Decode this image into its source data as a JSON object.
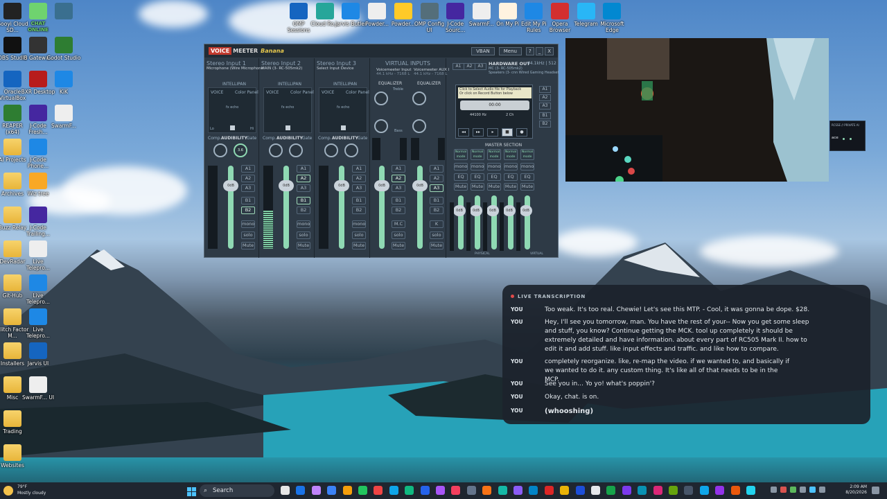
{
  "desktop_left": [
    {
      "label": "Gooyi Cloud SD...",
      "color": "#222"
    },
    {
      "label": "CHAT ONLINE",
      "color": "#6fd36f"
    },
    {
      "label": "",
      "color": "#3a6f8f"
    },
    {
      "label": "OBS Studio",
      "color": "#111"
    },
    {
      "label": "IB Gatewa...",
      "color": "#333"
    },
    {
      "label": "Godot Studio",
      "color": "#2e7d32"
    },
    {
      "label": "Oracle VirtualBox",
      "color": "#1565c0"
    },
    {
      "label": "BXR Desktop",
      "color": "#b71c1c"
    },
    {
      "label": "KiK",
      "color": "#1e88e5"
    },
    {
      "label": "REAPER (x64)",
      "color": "#2e7d32"
    },
    {
      "label": "J-Code Fresh...",
      "color": "#4527a0"
    },
    {
      "label": "SwarmF...",
      "color": "#eee"
    },
    {
      "label": "AI Projects",
      "color": "folder"
    },
    {
      "label": "J-Code Phone...",
      "color": "#1e88e5"
    },
    {
      "label": "Archives",
      "color": "folder"
    },
    {
      "label": "Wiz tree",
      "color": "#f9a825"
    },
    {
      "label": "Buzz Relay",
      "color": "folder"
    },
    {
      "label": "J-Code Trailing...",
      "color": "#4527a0"
    },
    {
      "label": "DevRadar",
      "color": "folder"
    },
    {
      "label": "Live Telepro...",
      "color": "#eee"
    },
    {
      "label": "Git-Hub",
      "color": "folder"
    },
    {
      "label": "Live Telepro...",
      "color": "#1e88e5"
    },
    {
      "label": "Glitch Factor M...",
      "color": "folder"
    },
    {
      "label": "Live Telepro...",
      "color": "#1e88e5"
    },
    {
      "label": "Installers",
      "color": "folder"
    },
    {
      "label": "Jarvis UI",
      "color": "#1565c0"
    },
    {
      "label": "Misc",
      "color": "folder"
    },
    {
      "label": "SwarmF... UI",
      "color": "#eee"
    },
    {
      "label": "Trading",
      "color": "folder"
    },
    {
      "label": "Websites",
      "color": "folder"
    }
  ],
  "desktop_top": [
    {
      "label": "OMP Sessions",
      "color": "#1565c0"
    },
    {
      "label": "Cloud Ro...",
      "color": "#26a69a"
    },
    {
      "label": "Jarvis Butler",
      "color": "#1e88e5"
    },
    {
      "label": "Powder...",
      "color": "#eeeeee"
    },
    {
      "label": "Powder...",
      "color": "#ffca28"
    },
    {
      "label": "OMP Config UI",
      "color": "#546e7a"
    },
    {
      "label": "J-Code Sourc...",
      "color": "#4527a0"
    },
    {
      "label": "SwarmF...",
      "color": "#eeeeee"
    },
    {
      "label": "On My Pi",
      "color": "#fff3e0"
    },
    {
      "label": "Edit My Pi Rules",
      "color": "#1e88e5"
    },
    {
      "label": "Opera Browser",
      "color": "#d32f2f"
    },
    {
      "label": "Telegram",
      "color": "#29b6f6"
    },
    {
      "label": "Microsoft Edge",
      "color": "#0288d1"
    }
  ],
  "voicemeeter": {
    "logo_voice": "VOICE",
    "logo_meeter": "MEETER",
    "logo_banana": "Banana",
    "vban": "VBAN",
    "menu": "Menu",
    "help": "?",
    "minimize": "_",
    "close": "X",
    "strips": [
      {
        "name": "Stereo Input 1",
        "device": "Microphone (Wire Microphone"
      },
      {
        "name": "Stereo Input 2",
        "device": "MAIN (3- RC-505mk2)"
      },
      {
        "name": "Stereo Input 3",
        "device": "Select Input Device"
      }
    ],
    "virtual_inputs": "VIRTUAL INPUTS",
    "virt1": "Voicemeeter Input",
    "virt1_rate": "44.1 kHz - 7168 L",
    "virt2": "Voicemeeter AUX I",
    "virt2_rate": "44.1 kHz - 7168 L",
    "hardware_out": "HARDWARE OUT",
    "hardware_rate": "44.1kHz | 512",
    "hw_a1": "MC (3- RC-505mk2)",
    "hw_a2": "Speakers (3- cnn Wired Gaming Headset",
    "intellipan": "INTELLIPAN",
    "voice": "VOICE",
    "color_panel": "Color Panel",
    "fx_echo": "fx echo",
    "brightness": "brightness",
    "lo": "Lo",
    "hi": "Hi",
    "comp": "Comp.",
    "audibility": "AUDIBILITY",
    "gate": "Gate",
    "equalizer": "EQUALIZER",
    "treble": "Treble",
    "bass": "Bass",
    "fader_gain": "Fader Gain",
    "db": "0dB",
    "knob_val": "3.6",
    "tape_prompt1": "Click to Select Audio file for Playback",
    "tape_prompt2": "Or click on Record Button below",
    "tape_time": "00:00",
    "tape_rate": "44100 Hz",
    "tape_ch": "2 Ch",
    "master_section": "MASTER SECTION",
    "normal_mode": "Normal mode",
    "physical": "PHYSICAL",
    "virtual": "VIRTUAL",
    "bus_labels": [
      "A1",
      "A2",
      "A3",
      "B1",
      "B2"
    ],
    "mono": "mono",
    "solo": "solo",
    "mute": "Mute",
    "mc": "M.C",
    "k": "K",
    "eq": "EQ",
    "a1": "A1",
    "a2": "A2",
    "a3": "A3"
  },
  "side_widget_text": "RCSSE // PRIVATE AI",
  "side_widget_sub": "ace",
  "transcription": {
    "header": "LIVE TRANSCRIPTION",
    "rows": [
      {
        "who": "YOU",
        "text": "Too weak. It's too real. Chewie! Let's see this MTP. - Cool, it was gonna be dope. $28."
      },
      {
        "who": "YOU",
        "text": "Hey, I'll see you tomorrow, man. You have the rest of your-- Now you get some sleep and stuff, you know? Continue getting the MCK. tool up completely it should be extremely detailed and have information. about every part of RC505 Mark II. how to edit it and add stuff. like input effects and traffic. and like how to compare."
      },
      {
        "who": "YOU",
        "text": "completely reorganize. like, re-map the video. if we wanted to, and basically if we wanted to do it. any custom thing. It's like all of that needs to be in the MCP."
      },
      {
        "who": "YOU",
        "text": "See you in... Yo yo! what's poppin'?"
      },
      {
        "who": "YOU",
        "text": "Okay, chat. is on."
      },
      {
        "who": "YOU",
        "text": "(whooshing)"
      }
    ]
  },
  "taskbar": {
    "weather_temp": "79°F",
    "weather_desc": "Mostly cloudy",
    "search_label": "Search",
    "time": "2:09 AM",
    "date": "8/20/2026",
    "app_colors": [
      "#e6e6e6",
      "#1a73e8",
      "#c084fc",
      "#3b82f6",
      "#f59e0b",
      "#22c55e",
      "#ef4444",
      "#0ea5e9",
      "#10b981",
      "#2563eb",
      "#a855f7",
      "#f43f5e",
      "#64748b",
      "#f97316",
      "#14b8a6",
      "#8b5cf6",
      "#0284c7",
      "#dc2626",
      "#eab308",
      "#1d4ed8",
      "#e5e7eb",
      "#16a34a",
      "#7c3aed",
      "#0891b2",
      "#db2777",
      "#65a30d",
      "#475569",
      "#0ea5e9",
      "#9333ea",
      "#ea580c",
      "#22d3ee"
    ]
  }
}
